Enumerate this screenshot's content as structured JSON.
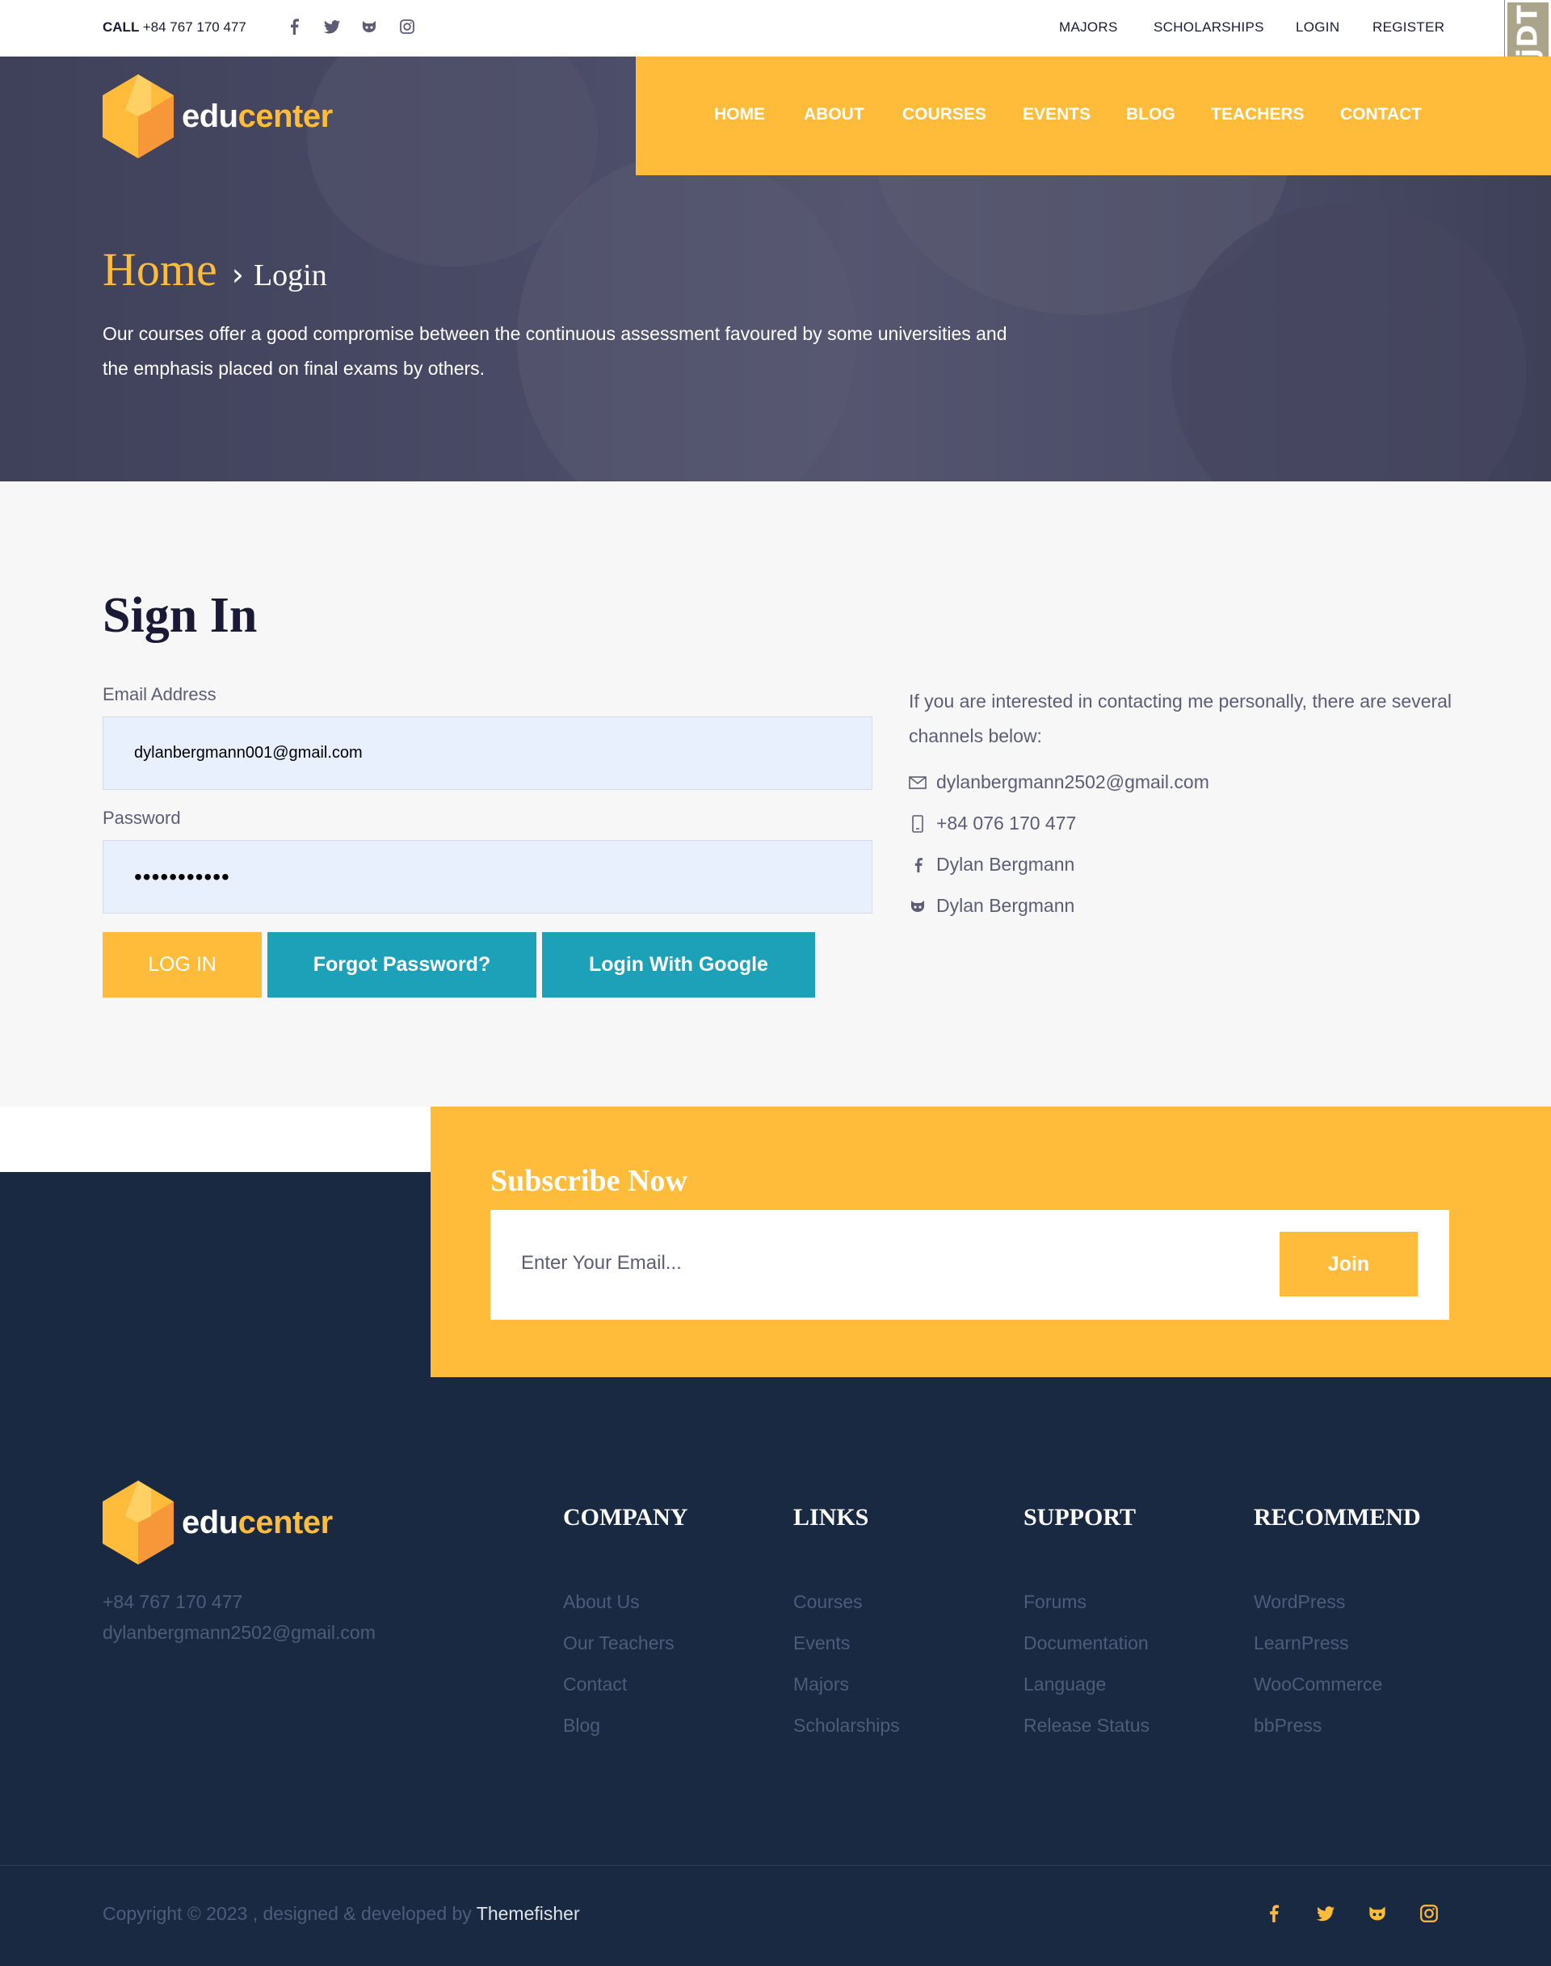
{
  "topbar": {
    "call_label": "CALL",
    "phone": "+84 767 170 477",
    "social_icons": [
      "facebook-icon",
      "twitter-icon",
      "github-icon",
      "instagram-icon"
    ],
    "links": [
      "MAJORS",
      "SCHOLARSHIPS",
      "LOGIN",
      "REGISTER"
    ]
  },
  "debug_toolbar": {
    "label": "DjDT"
  },
  "brand": {
    "edu": "edu",
    "center": "center"
  },
  "nav": {
    "items": [
      "HOME",
      "ABOUT",
      "COURSES",
      "EVENTS",
      "BLOG",
      "TEACHERS",
      "CONTACT"
    ]
  },
  "hero": {
    "breadcrumb_home": "Home",
    "breadcrumb_current": "Login",
    "text": "Our courses offer a good compromise between the continuous assessment favoured by some universities and the emphasis placed on final exams by others."
  },
  "signin": {
    "title": "Sign In",
    "email_label": "Email Address",
    "email_value": "dylanbergmann001@gmail.com",
    "password_label": "Password",
    "password_value": "•••••••••••",
    "login_button": "LOG IN",
    "forgot_button": "Forgot Password?",
    "google_button": "Login With Google"
  },
  "contact": {
    "intro": "If you are interested in contacting me personally, there are several channels below:",
    "email": "dylanbergmann2502@gmail.com",
    "phone": "+84 076 170 477",
    "facebook": "Dylan Bergmann",
    "github": "Dylan Bergmann"
  },
  "subscribe": {
    "title": "Subscribe Now",
    "placeholder": "Enter Your Email...",
    "join_button": "Join"
  },
  "footer": {
    "phone": "+84 767 170 477",
    "email": "dylanbergmann2502@gmail.com",
    "columns": [
      {
        "heading": "COMPANY",
        "links": [
          "About Us",
          "Our Teachers",
          "Contact",
          "Blog"
        ]
      },
      {
        "heading": "LINKS",
        "links": [
          "Courses",
          "Events",
          "Majors",
          "Scholarships"
        ]
      },
      {
        "heading": "SUPPORT",
        "links": [
          "Forums",
          "Documentation",
          "Language",
          "Release Status"
        ]
      },
      {
        "heading": "RECOMMEND",
        "links": [
          "WordPress",
          "LearnPress",
          "WooCommerce",
          "bbPress"
        ]
      }
    ],
    "copyright": "Copyright © 2023 , designed & developed by",
    "credit": "Themefisher"
  },
  "colors": {
    "accent": "#ffbc3b",
    "teal": "#1da1b8",
    "navy": "#1a2942",
    "heading": "#1a1a37"
  }
}
